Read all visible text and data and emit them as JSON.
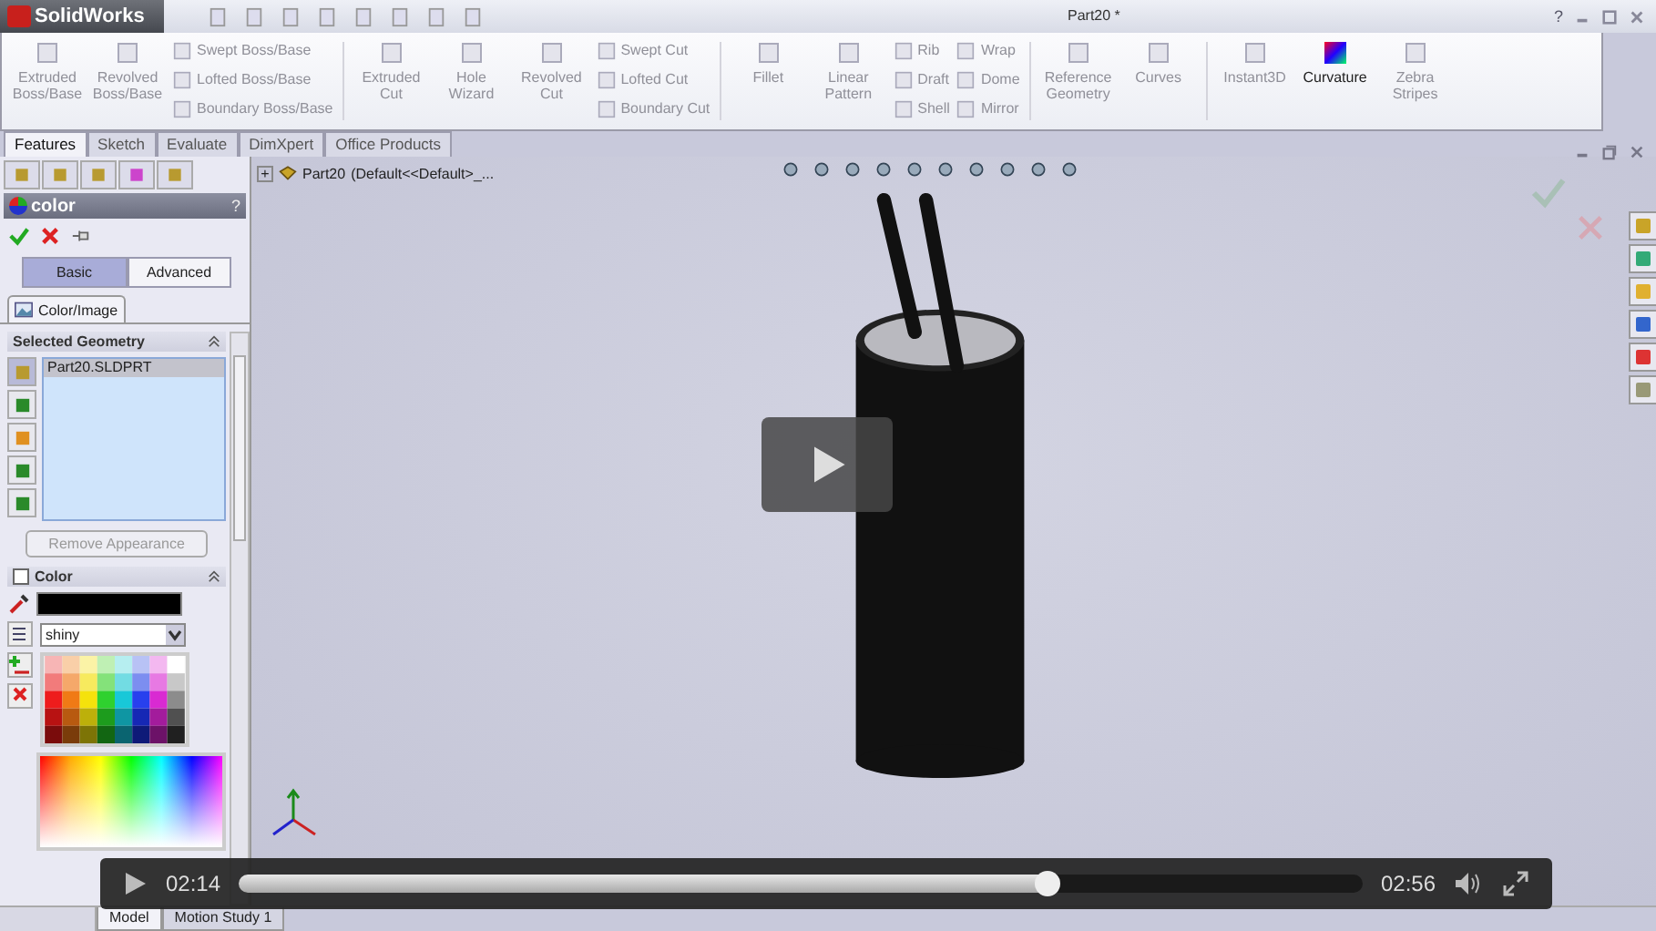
{
  "title_bar": {
    "app_name": "SolidWorks",
    "document_title": "Part20 *",
    "help": "?"
  },
  "ribbon": {
    "groups": [
      {
        "columns": [
          {
            "kind": "large",
            "label": "Extruded Boss/Base",
            "disabled": true
          },
          {
            "kind": "large",
            "label": "Revolved Boss/Base",
            "disabled": true
          },
          {
            "kind": "stack",
            "items": [
              {
                "label": "Swept Boss/Base",
                "disabled": true
              },
              {
                "label": "Lofted Boss/Base",
                "disabled": true
              },
              {
                "label": "Boundary Boss/Base",
                "disabled": true
              }
            ]
          }
        ]
      },
      {
        "columns": [
          {
            "kind": "large",
            "label": "Extruded Cut",
            "disabled": true
          },
          {
            "kind": "large",
            "label": "Hole Wizard",
            "disabled": true
          },
          {
            "kind": "large",
            "label": "Revolved Cut",
            "disabled": true
          },
          {
            "kind": "stack",
            "items": [
              {
                "label": "Swept Cut",
                "disabled": true
              },
              {
                "label": "Lofted Cut",
                "disabled": true
              },
              {
                "label": "Boundary Cut",
                "disabled": true
              }
            ]
          }
        ]
      },
      {
        "columns": [
          {
            "kind": "large",
            "label": "Fillet",
            "disabled": true
          },
          {
            "kind": "large",
            "label": "Linear Pattern",
            "disabled": true
          },
          {
            "kind": "stack",
            "items": [
              {
                "label": "Rib",
                "disabled": true
              },
              {
                "label": "Draft",
                "disabled": true
              },
              {
                "label": "Shell",
                "disabled": true
              }
            ]
          },
          {
            "kind": "stack",
            "items": [
              {
                "label": "Wrap",
                "disabled": true
              },
              {
                "label": "Dome",
                "disabled": true
              },
              {
                "label": "Mirror",
                "disabled": true
              }
            ]
          }
        ]
      },
      {
        "columns": [
          {
            "kind": "large",
            "label": "Reference Geometry",
            "disabled": true
          },
          {
            "kind": "large",
            "label": "Curves",
            "disabled": true
          }
        ]
      },
      {
        "columns": [
          {
            "kind": "large",
            "label": "Instant3D",
            "disabled": true
          },
          {
            "kind": "large",
            "label": "Curvature",
            "disabled": false
          },
          {
            "kind": "large",
            "label": "Zebra Stripes",
            "disabled": true
          }
        ]
      }
    ]
  },
  "command_tabs": [
    {
      "label": "Features",
      "selected": true
    },
    {
      "label": "Sketch",
      "selected": false
    },
    {
      "label": "Evaluate",
      "selected": false
    },
    {
      "label": "DimXpert",
      "selected": false
    },
    {
      "label": "Office Products",
      "selected": false
    }
  ],
  "property_manager": {
    "title": "color",
    "help": "?",
    "modes": [
      {
        "label": "Basic",
        "selected": true
      },
      {
        "label": "Advanced",
        "selected": false
      }
    ],
    "tab": "Color/Image",
    "selected_geometry": {
      "title": "Selected Geometry",
      "items": [
        {
          "label": "Part20.SLDPRT",
          "selected": true
        }
      ],
      "button": "Remove Appearance"
    },
    "color": {
      "title": "Color",
      "checked": false,
      "finish": "shiny"
    }
  },
  "feature_tree": {
    "expander": "+",
    "root": "Part20",
    "configuration": "(Default<<Default>_..."
  },
  "bottom_tabs": [
    {
      "label": "Model",
      "selected": true
    },
    {
      "label": "Motion Study 1",
      "selected": false
    }
  ],
  "video_player": {
    "elapsed": "02:14",
    "duration": "02:56",
    "level": 0.72
  }
}
